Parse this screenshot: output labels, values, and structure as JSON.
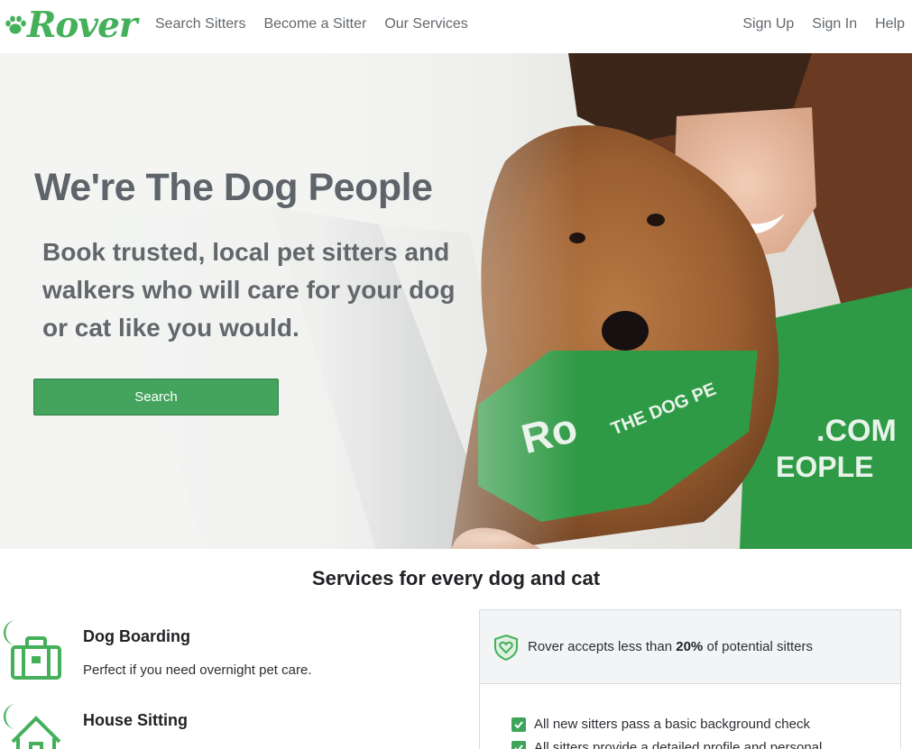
{
  "header": {
    "logo_text": "Rover",
    "nav_left": [
      "Search Sitters",
      "Become a Sitter",
      "Our Services"
    ],
    "nav_right": [
      "Sign Up",
      "Sign In",
      "Help"
    ]
  },
  "hero": {
    "title": "We're The Dog People",
    "subtitle": "Book trusted, local pet sitters and walkers who will care for your dog or cat like you would.",
    "search_button": "Search"
  },
  "services": {
    "title": "Services for every dog and cat",
    "items": [
      {
        "name": "Dog Boarding",
        "description": "Perfect if you need overnight pet care.",
        "icon": "suitcase-moon-icon"
      },
      {
        "name": "House Sitting",
        "description": "",
        "icon": "house-moon-icon"
      }
    ]
  },
  "trust": {
    "prefix": "Rover accepts less than ",
    "highlight": "20%",
    "suffix": " of potential sitters",
    "checks": [
      "All new sitters pass a basic background check",
      "All sitters provide a detailed profile and personal"
    ]
  },
  "colors": {
    "brand_green": "#44b05a",
    "button_green": "#44a45e",
    "shirt_green": "#2f9a45"
  }
}
